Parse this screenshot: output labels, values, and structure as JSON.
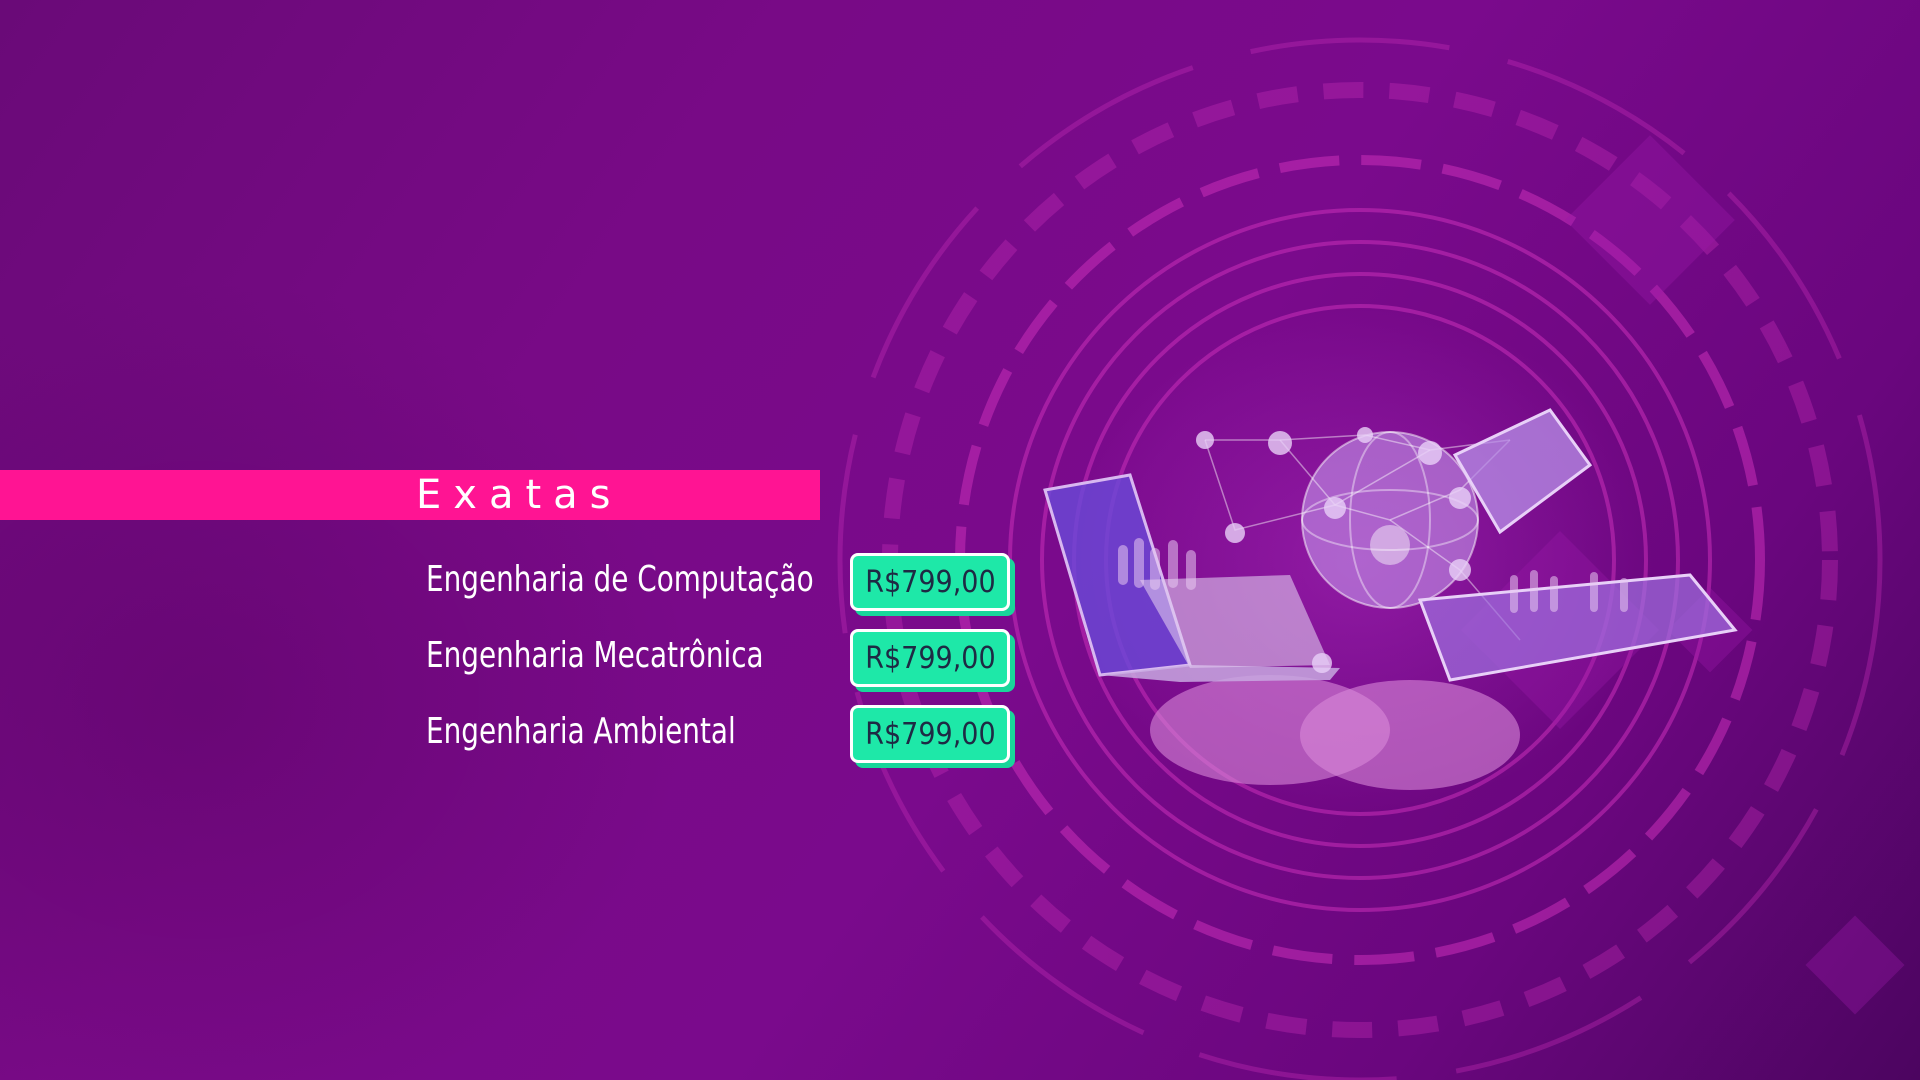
{
  "category": {
    "title": "Exatas"
  },
  "courses": [
    {
      "name": "Engenharia de Computação",
      "price": "R$799,00"
    },
    {
      "name": "Engenharia Mecatrônica",
      "price": "R$799,00"
    },
    {
      "name": "Engenharia Ambiental",
      "price": "R$799,00"
    }
  ],
  "colors": {
    "background": "#7a0a8c",
    "category_bar": "#ff1493",
    "price_fill": "#1ee8a8",
    "price_text": "#1e2a44",
    "text": "#ffffff"
  }
}
